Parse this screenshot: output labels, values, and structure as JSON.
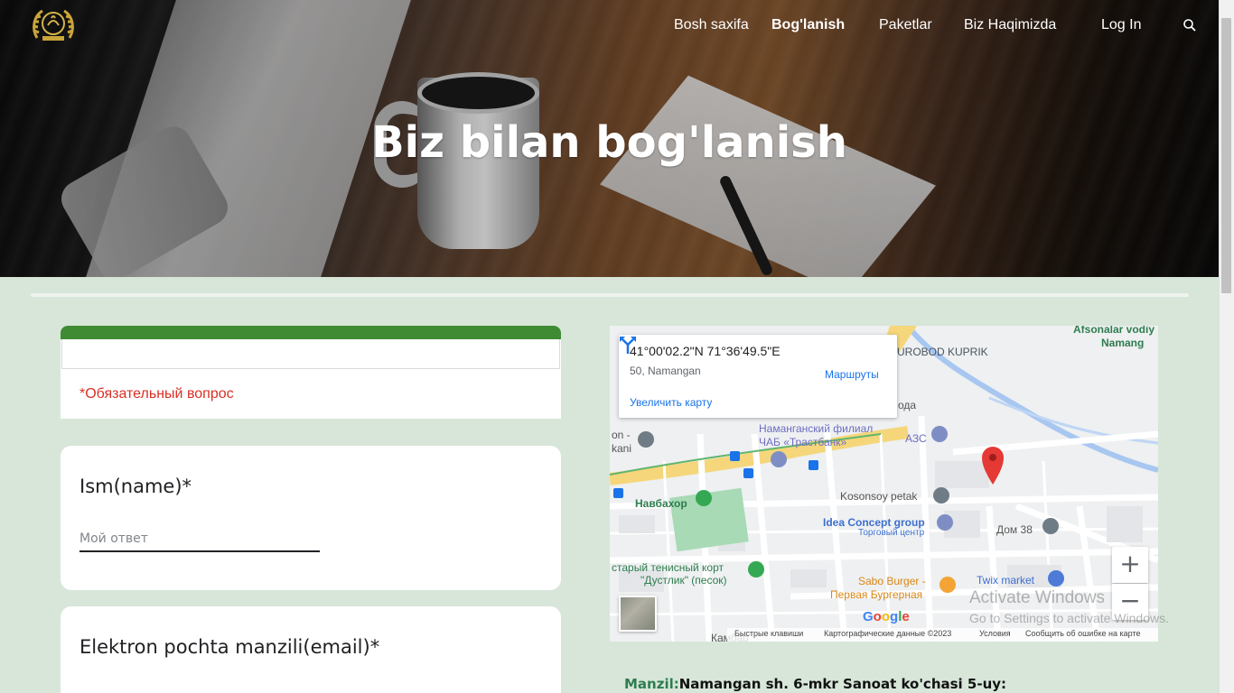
{
  "nav": {
    "items": [
      {
        "label": "Bosh saxifa",
        "active": false
      },
      {
        "label": "Bog'lanish",
        "active": true
      },
      {
        "label": "Paketlar",
        "active": false
      },
      {
        "label": "Biz Haqimizda",
        "active": false
      },
      {
        "label": "Log In",
        "active": false
      }
    ],
    "search_icon": "search-icon"
  },
  "hero": {
    "title": "Biz bilan bog'lanish"
  },
  "form": {
    "required_note": "*Обязательный вопрос",
    "accent_color": "#3f8b34",
    "questions": [
      {
        "title": "Ism(name)*",
        "placeholder": "Мой ответ"
      },
      {
        "title": "Elektron pochta manzili(email)*"
      }
    ]
  },
  "map": {
    "coords": "41°00'02.2\"N 71°36'49.5\"E",
    "address": "50, Namangan",
    "enlarge_link": "Увеличить карту",
    "routes_label": "Маршруты",
    "labels": {
      "top_right_1": "Afsonalar vodiy",
      "top_right_2": "Namang",
      "bridge": "UROBOD KUPRIK",
      "bank_1": "Наманганский филиал",
      "bank_2": "ЧАБ «Трастбанк»",
      "azs": "АЗС",
      "oda": "ода",
      "on": "on -",
      "kani": "kani",
      "navbahor": "Навбахор",
      "petak": "Kosonsoy petak",
      "idea": "Idea Concept group",
      "torg": "Торговый центр",
      "dom": "Дом 38",
      "tennis_1": "старый тенисный корт",
      "tennis_2": "\"Дустлик\" (песок)",
      "twix": "Twix market",
      "sabo_1": "Sabo Burger -",
      "sabo_2": "Первая Бургерная",
      "kambar": "Камбар"
    },
    "zoom_in": "+",
    "zoom_out": "−",
    "google": "Google",
    "footer": [
      "Быстрые клавиши",
      "Картографические данные ©2023",
      "Условия",
      "Сообщить об ошибке на карте"
    ]
  },
  "watermark": {
    "line1": "Activate Windows",
    "line2": "Go to Settings to activate Windows."
  },
  "contact": {
    "label": "Manzil:",
    "address": "Namangan sh. 6-mkr Sanoat ko'chasi 5-uy:"
  }
}
